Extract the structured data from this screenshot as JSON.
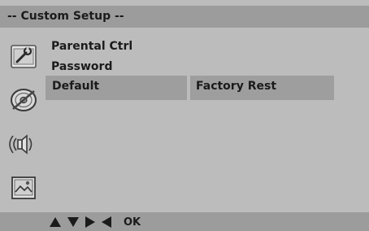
{
  "header": {
    "title": "-- Custom  Setup --"
  },
  "menu": {
    "items": [
      {
        "label": "Parental Ctrl"
      },
      {
        "label": "Password"
      }
    ],
    "selected_row": {
      "label": "Default",
      "value": "Factory Rest"
    }
  },
  "sidebar": {
    "icons": [
      "settings-icon",
      "disc-icon",
      "speaker-icon",
      "picture-icon"
    ]
  },
  "footer": {
    "nav_glyphs": [
      "up-arrow",
      "down-arrow",
      "right-arrow",
      "left-arrow"
    ],
    "ok_label": "OK"
  },
  "colors": {
    "background": "#bcbcbc",
    "bar": "#9c9c9c",
    "highlight": "#9e9e9e",
    "text": "#1b1b1b"
  }
}
